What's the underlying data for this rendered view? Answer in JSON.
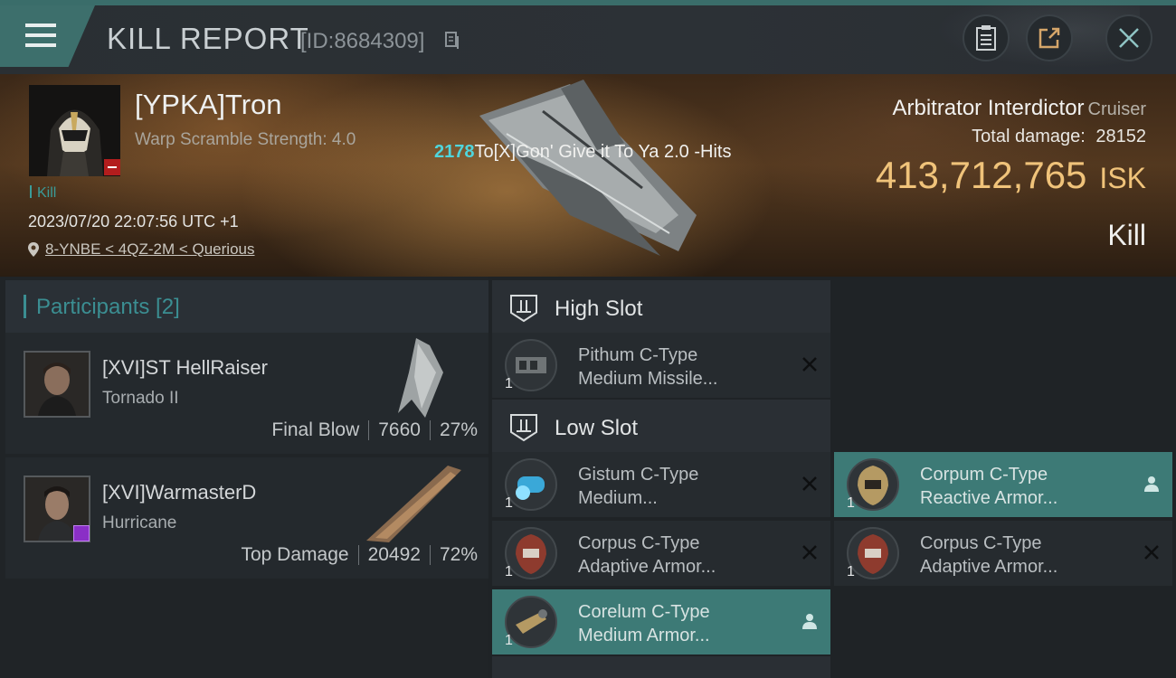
{
  "header": {
    "title": "KILL REPORT",
    "report_id": "[ID:8684309]"
  },
  "victim": {
    "name": "[YPKA]Tron",
    "scramble": "Warp Scramble Strength: 4.0",
    "tag": "Kill",
    "time": "2023/07/20 22:07:56 UTC +1",
    "location": "8-YNBE < 4QZ-2M < Querious",
    "ship_name": "Arbitrator Interdictor",
    "ship_class": "Cruiser",
    "total_damage_label": "Total damage:",
    "total_damage": "28152",
    "isk_value": "413,712,765",
    "isk_unit": "ISK",
    "result": "Kill"
  },
  "hit": {
    "number": "2178",
    "text": "To[X]Gon' Give it To Ya 2.0 -Hits"
  },
  "participants": {
    "header": "Participants [2]",
    "rows": [
      {
        "name": "[XVI]ST HellRaiser",
        "ship": "Tornado II",
        "role": "Final Blow",
        "damage": "7660",
        "percent": "27%"
      },
      {
        "name": "[XVI]WarmasterD",
        "ship": "Hurricane",
        "role": "Top Damage",
        "damage": "20492",
        "percent": "72%"
      }
    ]
  },
  "slots": {
    "high": {
      "label": "High Slot",
      "modules": [
        {
          "qty": "1",
          "line1": "Pithum C-Type",
          "line2": "Medium Missile..."
        }
      ]
    },
    "low": {
      "label": "Low Slot",
      "modules": [
        {
          "qty": "1",
          "line1": "Gistum C-Type",
          "line2": "Medium..."
        },
        {
          "qty": "1",
          "line1": "Corpum C-Type",
          "line2": "Reactive Armor..."
        },
        {
          "qty": "1",
          "line1": "Corpus C-Type",
          "line2": "Adaptive Armor..."
        },
        {
          "qty": "1",
          "line1": "Corpus C-Type",
          "line2": "Adaptive Armor..."
        },
        {
          "qty": "1",
          "line1": "Corelum C-Type",
          "line2": "Medium Armor..."
        }
      ]
    }
  },
  "colors": {
    "accent": "#3d7a76",
    "isk_gold": "#f0c37a",
    "hit_cyan": "#4fd5dc",
    "participants_title": "#3b8e92"
  },
  "icons": [
    "menu-icon",
    "copy-icon",
    "clipboard-icon",
    "share-icon",
    "close-icon",
    "location-pin-icon",
    "high-slot-icon",
    "low-slot-icon",
    "remove-x-icon",
    "pilot-icon"
  ]
}
